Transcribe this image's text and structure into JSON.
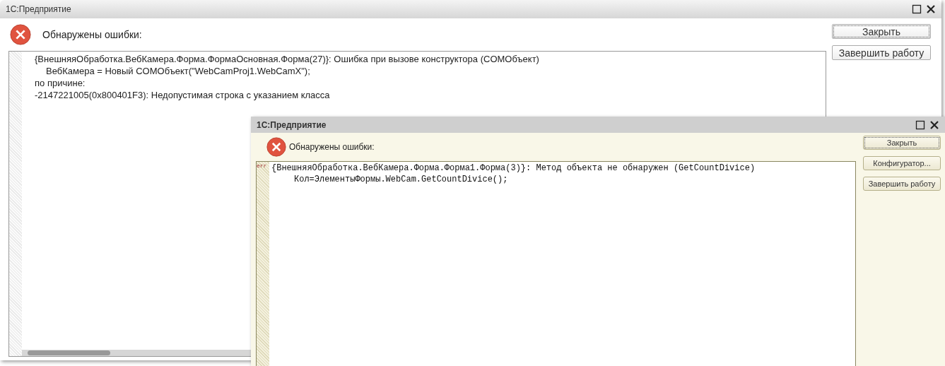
{
  "windows": [
    {
      "kind": "modern",
      "title": "1С:Предприятие",
      "message": "Обнаружены ошибки:",
      "lines": [
        {
          "text": "{ВнешняяОбработка.ВебКамера.Форма.ФормаОсновная.Форма(27)}: Ошибка при вызове конструктора (COMОбъект)",
          "indent": false
        },
        {
          "text": "ВебКамера = Новый COMОбъект(\"WebCamProj1.WebCamX\");",
          "indent": true
        },
        {
          "text": "по причине:",
          "indent": false
        },
        {
          "text": "-2147221005(0x800401F3): Недопустимая строка с указанием класса",
          "indent": false
        }
      ],
      "buttons": [
        {
          "label": "Закрыть",
          "focused": true
        },
        {
          "label": "Завершить работу",
          "focused": false
        }
      ]
    },
    {
      "kind": "classic",
      "title": "1С:Предприятие",
      "message": "Обнаружены ошибки:",
      "gutter_mark": "err",
      "lines": [
        {
          "text": "{ВнешняяОбработка.ВебКамера.Форма.Форма1.Форма(3)}: Метод объекта не обнаружен (GetCountDivice)",
          "indent": false
        },
        {
          "text": "Кол=ЭлементыФормы.WebCam.GetCountDivice();",
          "indent": true
        }
      ],
      "buttons": [
        {
          "label": "Закрыть",
          "focused": true
        },
        {
          "label": "Конфигуратор...",
          "focused": false
        },
        {
          "label": "Завершить работу",
          "focused": false
        }
      ]
    }
  ]
}
